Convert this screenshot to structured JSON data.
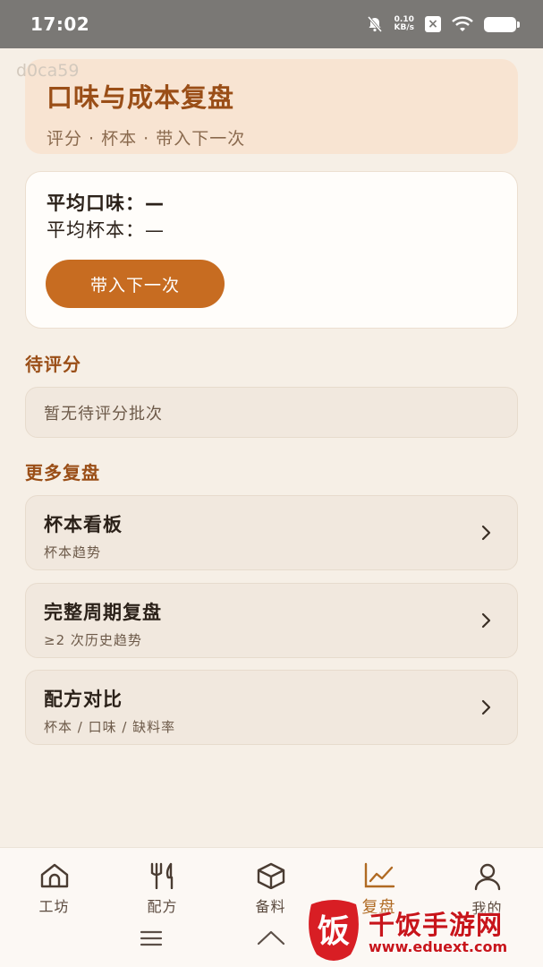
{
  "status_bar": {
    "time": "17:02",
    "net_speed_value": "0.10",
    "net_speed_unit": "KB/s",
    "icons": [
      "bell-muted-icon",
      "sim-icon",
      "wifi-icon",
      "battery-icon"
    ]
  },
  "debug_code": "d0ca59",
  "header": {
    "title": "口味与成本复盘",
    "subtitle": "评分 · 杯本 · 带入下一次"
  },
  "summary": {
    "avg_taste": "平均口味：—",
    "avg_cost": "平均杯本：—",
    "carry_button": "带入下一次"
  },
  "pending": {
    "title": "待评分",
    "empty_text": "暂无待评分批次"
  },
  "more": {
    "title": "更多复盘",
    "items": [
      {
        "title": "杯本看板",
        "subtitle": "杯本趋势"
      },
      {
        "title": "完整周期复盘",
        "subtitle": "≥2 次历史趋势"
      },
      {
        "title": "配方对比",
        "subtitle": "杯本 / 口味 / 缺料率"
      }
    ]
  },
  "tab_bar": {
    "tabs": [
      {
        "label": "工坊",
        "icon": "home-icon"
      },
      {
        "label": "配方",
        "icon": "fork-knife-icon"
      },
      {
        "label": "备料",
        "icon": "box-icon"
      },
      {
        "label": "复盘",
        "icon": "chart-icon"
      },
      {
        "label": "我的",
        "icon": "user-icon"
      }
    ],
    "active": "复盘"
  },
  "site_watermark": {
    "logo_char": "饭",
    "name": "千饭手游网",
    "url": "www.eduext.com"
  },
  "colors": {
    "accent": "#c76c21",
    "title_brown": "#9a4e17",
    "background": "#f6efe6",
    "header_bg": "#f8e4d2"
  }
}
